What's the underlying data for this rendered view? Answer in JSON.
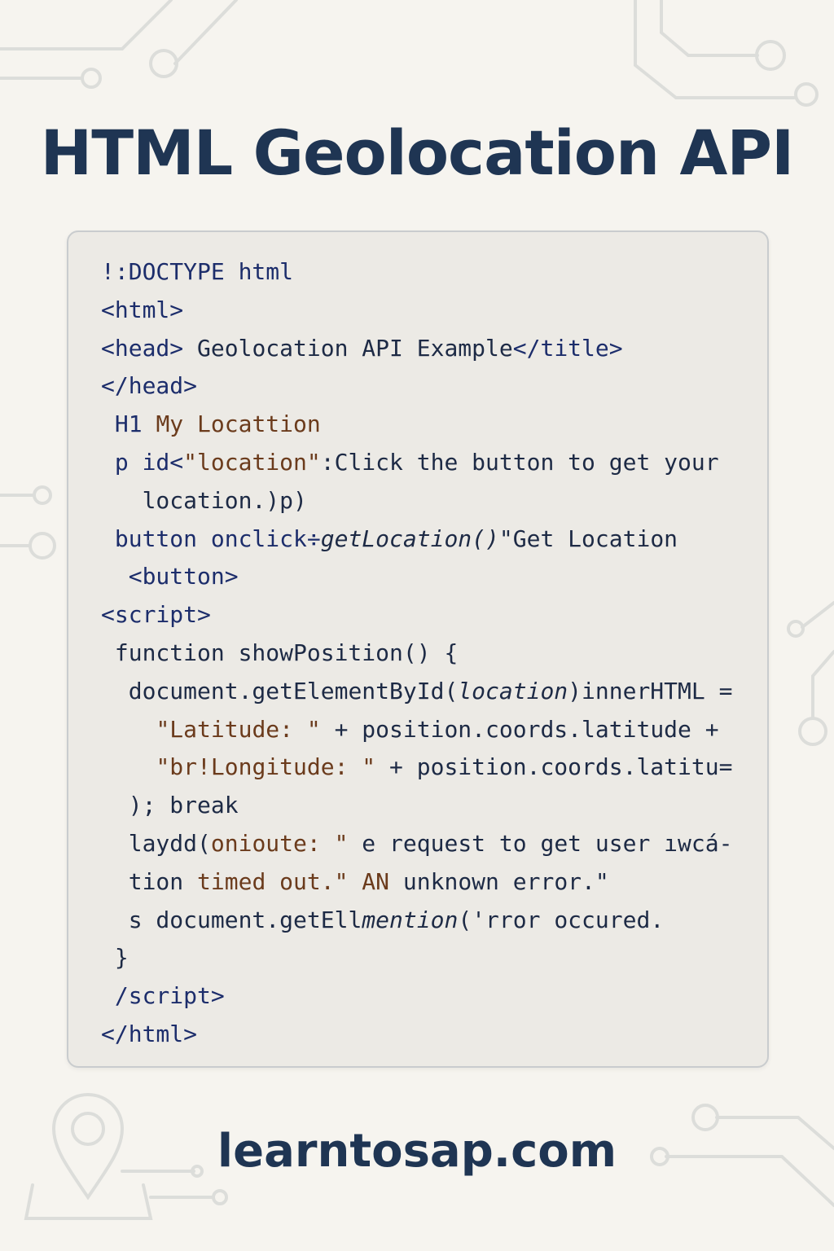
{
  "title": "HTML Geolocation API",
  "footer": "learntosap.com",
  "colors": {
    "background": "#f6f4ef",
    "title": "#1f3553",
    "code_card": "#eceae5",
    "code_text": "#1d2a45",
    "code_string": "#6b3b1c",
    "decor_lines": "#d9dad8"
  },
  "code_lines": [
    {
      "indent": "",
      "segments": [
        {
          "text": "!:DOCTYPE html",
          "style": "tag"
        }
      ]
    },
    {
      "indent": "",
      "segments": [
        {
          "text": "<html>",
          "style": "tag"
        }
      ]
    },
    {
      "indent": "",
      "segments": [
        {
          "text": "<head> ",
          "style": "tag"
        },
        {
          "text": "Geolocation API Example",
          "style": "plain"
        },
        {
          "text": "</title>",
          "style": "tag"
        }
      ]
    },
    {
      "indent": "",
      "segments": [
        {
          "text": "</head>",
          "style": "tag"
        }
      ]
    },
    {
      "indent": " ",
      "segments": [
        {
          "text": "H1 ",
          "style": "tag"
        },
        {
          "text": "My Locattion",
          "style": "str"
        }
      ]
    },
    {
      "indent": " ",
      "segments": [
        {
          "text": "p id<",
          "style": "tag"
        },
        {
          "text": "\"location\"",
          "style": "str"
        },
        {
          "text": ":Click the button to get your",
          "style": "plain"
        }
      ]
    },
    {
      "indent": "   ",
      "segments": [
        {
          "text": "location.)p)",
          "style": "plain"
        }
      ]
    },
    {
      "indent": " ",
      "segments": [
        {
          "text": "button onclick÷",
          "style": "tag"
        },
        {
          "text": "getLocation()",
          "style": "ital"
        },
        {
          "text": "\"Get Location",
          "style": "plain"
        }
      ]
    },
    {
      "indent": "  ",
      "segments": [
        {
          "text": "<button>",
          "style": "tag"
        }
      ]
    },
    {
      "indent": "",
      "segments": [
        {
          "text": "<script>",
          "style": "tag"
        }
      ]
    },
    {
      "indent": " ",
      "segments": [
        {
          "text": "function showPosition() {",
          "style": "plain"
        }
      ]
    },
    {
      "indent": "  ",
      "segments": [
        {
          "text": "document.getElementById(",
          "style": "plain"
        },
        {
          "text": "location",
          "style": "ital"
        },
        {
          "text": ")innerHTML =",
          "style": "plain"
        }
      ]
    },
    {
      "indent": "    ",
      "segments": [
        {
          "text": "\"Latitude: \"",
          "style": "str"
        },
        {
          "text": " + position.coords.latitude +",
          "style": "plain"
        }
      ]
    },
    {
      "indent": "    ",
      "segments": [
        {
          "text": "\"br!Longitude: \"",
          "style": "str"
        },
        {
          "text": " + position.coords.latitu=",
          "style": "plain"
        }
      ]
    },
    {
      "indent": "  ",
      "segments": [
        {
          "text": "); break",
          "style": "plain"
        }
      ]
    },
    {
      "indent": "  ",
      "segments": [
        {
          "text": "laydd(",
          "style": "plain"
        },
        {
          "text": "onioute: \"",
          "style": "str"
        },
        {
          "text": " e request to get user ıwcá-",
          "style": "plain"
        }
      ]
    },
    {
      "indent": "  ",
      "segments": [
        {
          "text": "tion ",
          "style": "plain"
        },
        {
          "text": "timed out.\" AN",
          "style": "str"
        },
        {
          "text": " unknown error.\"",
          "style": "plain"
        }
      ]
    },
    {
      "indent": "  ",
      "segments": [
        {
          "text": "s document.getEll",
          "style": "plain"
        },
        {
          "text": "mention",
          "style": "ital"
        },
        {
          "text": "('rror occured.",
          "style": "plain"
        }
      ]
    },
    {
      "indent": " ",
      "segments": [
        {
          "text": "}",
          "style": "plain"
        }
      ]
    },
    {
      "indent": " ",
      "segments": [
        {
          "text": "/script>",
          "style": "tag"
        }
      ]
    },
    {
      "indent": "",
      "segments": [
        {
          "text": "</html>",
          "style": "tag"
        }
      ]
    }
  ]
}
